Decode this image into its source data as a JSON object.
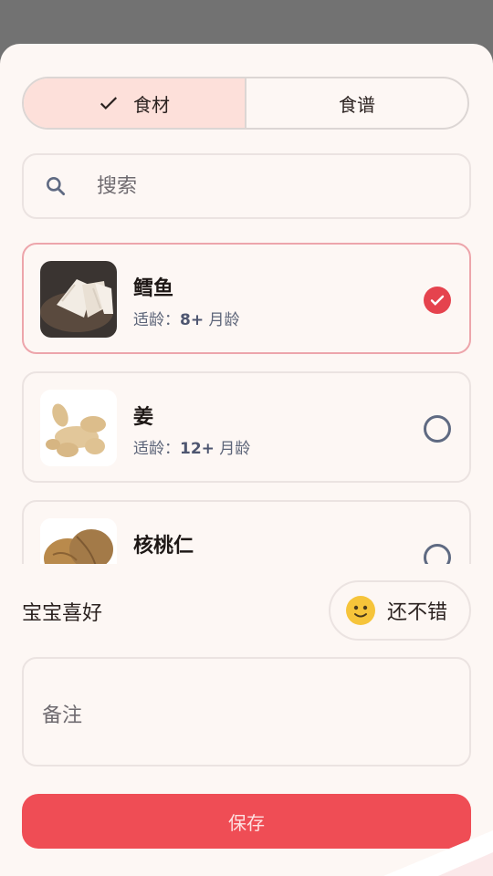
{
  "tabs": [
    {
      "label": "食材",
      "active": true
    },
    {
      "label": "食谱",
      "active": false
    }
  ],
  "search": {
    "placeholder": "搜索",
    "value": ""
  },
  "ingredients": [
    {
      "name": "鳕鱼",
      "age_prefix": "适龄：",
      "age_value": "8+",
      "age_unit": " 月龄",
      "selected": true
    },
    {
      "name": "姜",
      "age_prefix": "适龄：",
      "age_value": "12+",
      "age_unit": " 月龄",
      "selected": false
    },
    {
      "name": "核桃仁",
      "age_prefix": "",
      "age_value": "",
      "age_unit": "",
      "selected": false
    }
  ],
  "preference": {
    "label": "宝宝喜好",
    "value": "还不错",
    "icon": "smiley-face-icon"
  },
  "notes": {
    "placeholder": "备注",
    "value": ""
  },
  "save_label": "保存",
  "colors": {
    "accent": "#ef4d55",
    "selected_border": "#eda5ab",
    "tab_active_bg": "#fde0da",
    "sheet_bg": "#fdf7f4"
  }
}
